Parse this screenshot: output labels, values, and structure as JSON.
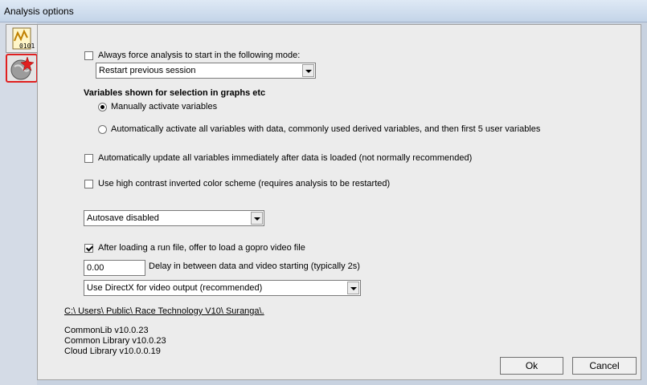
{
  "window": {
    "title": "Analysis options"
  },
  "options": {
    "force_mode_label": "Always force analysis to start in the following mode:",
    "force_mode_value": "Restart previous session",
    "variables_heading": "Variables shown for selection in graphs etc",
    "radio_manual": "Manually activate variables",
    "radio_auto": "Automatically activate all variables with data, commonly used derived variables, and then first 5 user variables",
    "auto_update_label": "Automatically update all variables immediately after data is loaded (not normally recommended)",
    "high_contrast_label": "Use high contrast inverted color scheme (requires analysis to be restarted)",
    "autosave_value": "Autosave disabled",
    "gopro_label": "After loading a run file, offer to load a gopro video file",
    "delay_value": "0.00",
    "delay_label": "Delay in between data and video starting (typically 2s)",
    "video_output_value": "Use DirectX for video output (recommended)",
    "path_link": "C:\\ Users\\ Public\\ Race Technology V10\\ Suranga\\.",
    "versions": [
      "CommonLib v10.0.23",
      "Common Library v10.0.23",
      "Cloud Library v10.0.0.19"
    ]
  },
  "buttons": {
    "ok": "Ok",
    "cancel": "Cancel"
  }
}
